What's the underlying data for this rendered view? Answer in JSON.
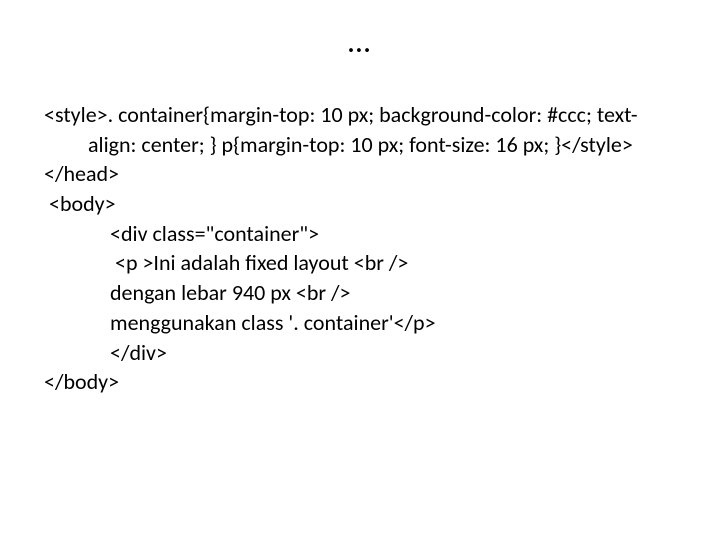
{
  "title": "…",
  "code": {
    "line1": "<style>. container{margin-top: 10 px; background-color: #ccc; text-",
    "line1b": "align: center; } p{margin-top: 10 px; font-size: 16 px; }</style>",
    "line2": "</head>",
    "line3": " <body>",
    "line4": "<div class=\"container\">",
    "line5": " <p >Ini adalah fixed layout <br />",
    "line6": "dengan lebar 940 px <br />",
    "line7": "menggunakan class '. container'</p>",
    "line8": "</div>",
    "line9": "</body>"
  }
}
